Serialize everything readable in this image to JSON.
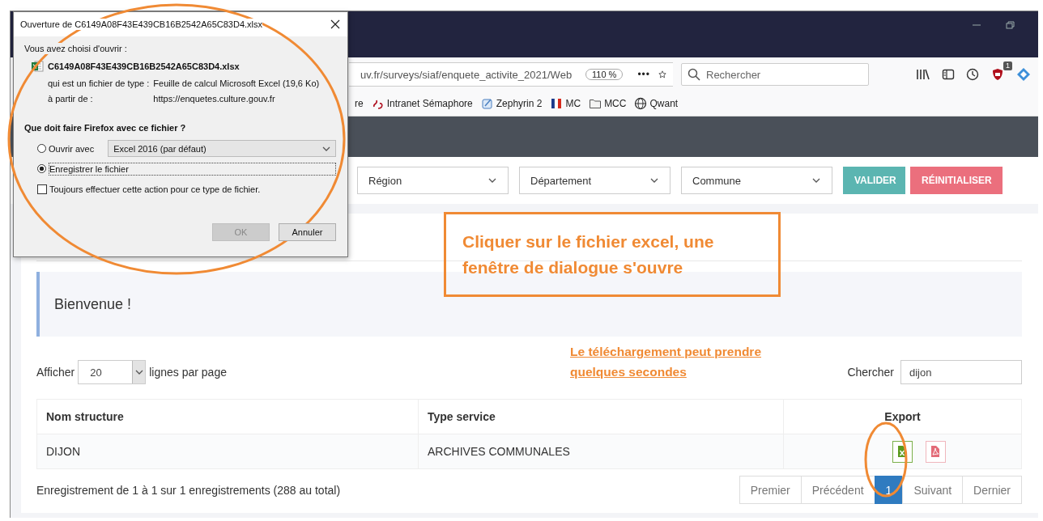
{
  "browser": {
    "url": "uv.fr/surveys/siaf/enquete_activite_2021/Web",
    "zoom": "110 %",
    "page_actions": "•••",
    "search_placeholder": "Rechercher",
    "toolbar_badge": "1",
    "bookmarks": [
      {
        "label": "re",
        "kind": "cut"
      },
      {
        "label": "Intranet Sémaphore",
        "kind": "semaphore"
      },
      {
        "label": "Zephyrin 2",
        "kind": "zephyrin"
      },
      {
        "label": "MC",
        "kind": "flag"
      },
      {
        "label": "MCC",
        "kind": "folder"
      },
      {
        "label": "Qwant",
        "kind": "globe"
      }
    ]
  },
  "filters": {
    "selects": [
      "Région",
      "Département",
      "Commune"
    ],
    "buttons": [
      {
        "label": "VALIDER",
        "kind": "validate"
      },
      {
        "label": "RÉINITIALISER",
        "kind": "reset"
      }
    ]
  },
  "welcome": "Bienvenue !",
  "table_controls": {
    "show_label": "Afficher",
    "page_size": "20",
    "page_size_suffix": "lignes par page",
    "search_label": "Chercher",
    "search_value": "dijon"
  },
  "table": {
    "columns": [
      "Nom structure",
      "Type service",
      "Export"
    ],
    "rows": [
      {
        "cells": [
          "DIJON",
          "ARCHIVES COMMUNALES"
        ],
        "exports": [
          {
            "kind": "excel"
          },
          {
            "kind": "pdf"
          }
        ]
      }
    ]
  },
  "summary": "Enregistrement de 1 à 1 sur 1 enregistrements (288 au total)",
  "pagination": [
    {
      "label": "Premier",
      "selected": false
    },
    {
      "label": "Précédent",
      "selected": false
    },
    {
      "label": "1",
      "selected": true
    },
    {
      "label": "Suivant",
      "selected": false
    },
    {
      "label": "Dernier",
      "selected": false
    }
  ],
  "dialog": {
    "title": "Ouverture de C6149A08F43E439CB16B2542A65C83D4.xlsx",
    "intro": "Vous avez choisi d'ouvrir :",
    "filename": "C6149A08F43E439CB16B2542A65C83D4.xlsx",
    "details": [
      {
        "label": "qui est un fichier de type :",
        "value": "Feuille de calcul Microsoft Excel (19,6 Ko)"
      },
      {
        "label": "à partir de :",
        "value": "https://enquetes.culture.gouv.fr"
      }
    ],
    "question": "Que doit faire Firefox avec ce fichier ?",
    "options": [
      {
        "label": "Ouvrir avec",
        "selected": false,
        "app": "Excel 2016 (par défaut)"
      },
      {
        "label": "Enregistrer le fichier",
        "selected": true
      }
    ],
    "always": {
      "label": "Toujours effectuer cette action pour ce type de fichier.",
      "checked": false
    },
    "buttons": [
      {
        "label": "OK",
        "disabled": true
      },
      {
        "label": "Annuler",
        "disabled": false
      }
    ]
  },
  "annotations": {
    "callout": "Cliquer sur le fichier excel, une fenêtre de dialogue s'ouvre",
    "note": "Le téléchargement peut prendre quelques secondes"
  }
}
